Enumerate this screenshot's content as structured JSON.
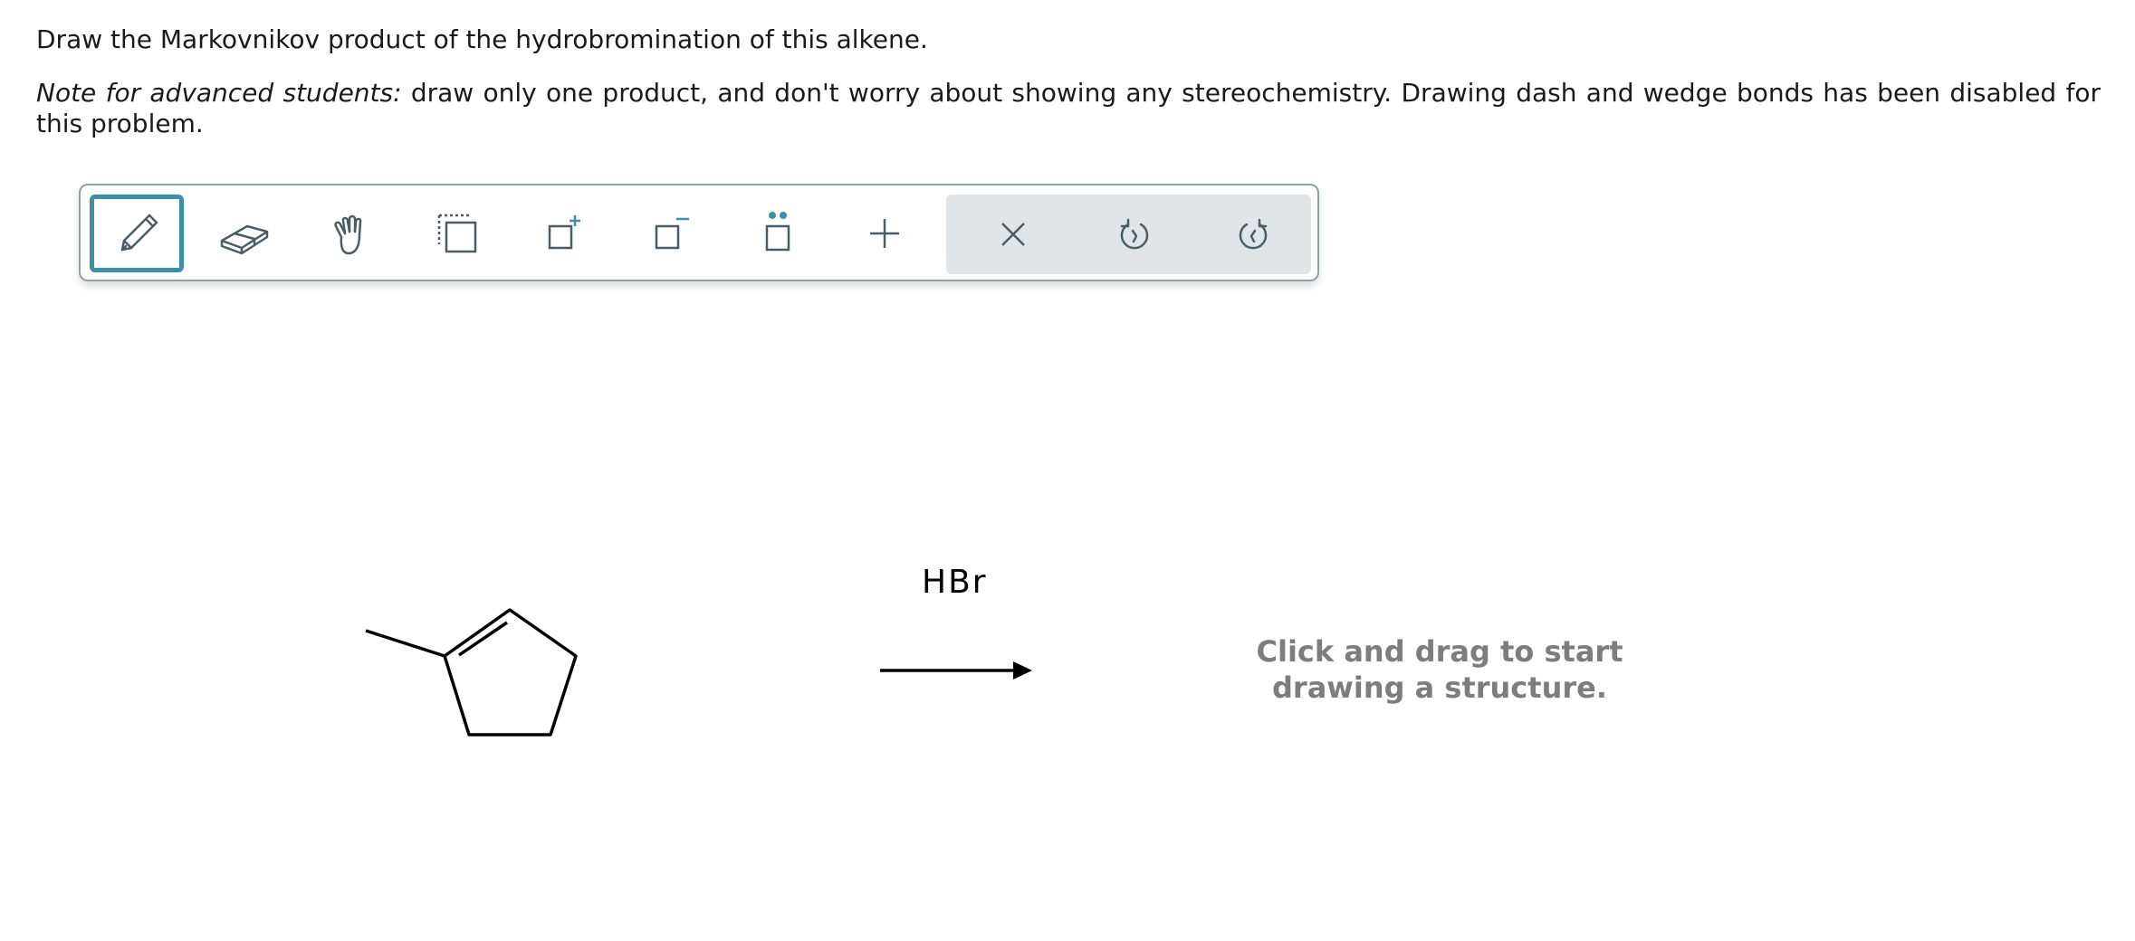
{
  "question": {
    "prompt": "Draw the Markovnikov product of the hydrobromination of this alkene.",
    "note_label": "Note for advanced students:",
    "note_text": " draw only one product, and don't worry about showing any stereochemistry. Drawing dash and wedge bonds has been disabled for this problem."
  },
  "toolbar": {
    "tools": [
      {
        "name": "pencil-tool",
        "icon": "pencil-icon",
        "selected": true
      },
      {
        "name": "eraser-tool",
        "icon": "eraser-icon",
        "selected": false
      },
      {
        "name": "hand-tool",
        "icon": "hand-icon",
        "selected": false
      },
      {
        "name": "select-tool",
        "icon": "lasso-select-icon",
        "selected": false
      },
      {
        "name": "add-charge-positive-tool",
        "icon": "positive-charge-icon",
        "selected": false
      },
      {
        "name": "add-charge-negative-tool",
        "icon": "negative-charge-icon",
        "selected": false
      },
      {
        "name": "lone-pair-tool",
        "icon": "lone-pair-icon",
        "selected": false
      },
      {
        "name": "add-atom-tool",
        "icon": "plus-icon",
        "selected": false
      }
    ],
    "actions": [
      {
        "name": "clear-button",
        "icon": "close-icon"
      },
      {
        "name": "undo-button",
        "icon": "undo-icon"
      },
      {
        "name": "redo-button",
        "icon": "redo-icon"
      }
    ],
    "accent_color": "#3d8fa8",
    "icon_color": "#4a5d66"
  },
  "reaction": {
    "reactant": "1-methylcyclopentene",
    "reagent": "HBr"
  },
  "canvas": {
    "hint_line1": "Click and drag to start",
    "hint_line2": "drawing a structure."
  }
}
